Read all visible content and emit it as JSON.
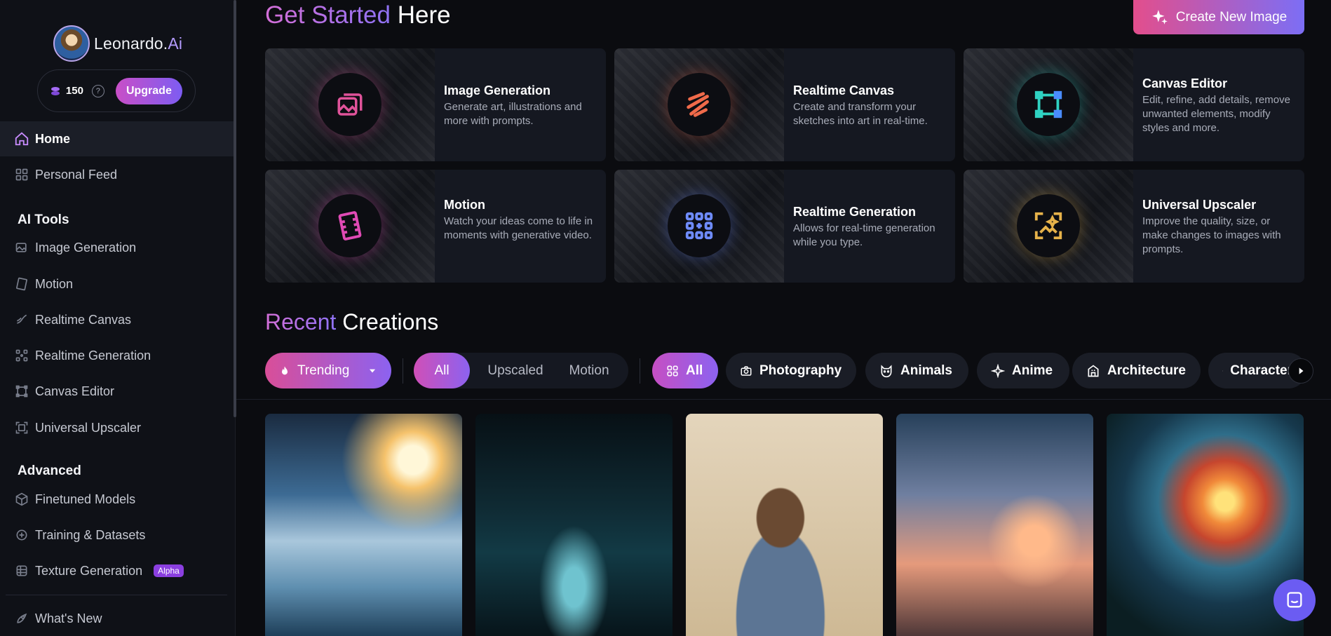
{
  "sidebar": {
    "brand": {
      "name": "Leonardo.",
      "ai": "Ai"
    },
    "tokens": {
      "count": "150",
      "help": "?",
      "upgrade_label": "Upgrade"
    },
    "nav": [
      {
        "label": "Home",
        "icon": "home-icon"
      },
      {
        "label": "Personal Feed",
        "icon": "grid-icon"
      }
    ],
    "ai_tools_heading": "AI Tools",
    "ai_tools": [
      {
        "label": "Image Generation",
        "icon": "image-icon"
      },
      {
        "label": "Motion",
        "icon": "film-icon"
      },
      {
        "label": "Realtime Canvas",
        "icon": "brush-icon"
      },
      {
        "label": "Realtime Generation",
        "icon": "dots-grid-icon"
      },
      {
        "label": "Canvas Editor",
        "icon": "frame-icon"
      },
      {
        "label": "Universal Upscaler",
        "icon": "upscale-icon"
      }
    ],
    "advanced_heading": "Advanced",
    "advanced": [
      {
        "label": "Finetuned Models",
        "icon": "cube-icon"
      },
      {
        "label": "Training & Datasets",
        "icon": "dataset-icon"
      },
      {
        "label": "Texture Generation",
        "icon": "texture-icon",
        "badge": "Alpha"
      }
    ],
    "whats_new": {
      "label": "What's New",
      "icon": "rocket-icon"
    }
  },
  "header": {
    "title_accent": "Get Started",
    "title_rest": " Here",
    "create_button": "Create New Image"
  },
  "cards": [
    {
      "title": "Image Generation",
      "desc": "Generate art, illustrations and more with prompts.",
      "icon": "image-stack-icon",
      "color": "#e0539a"
    },
    {
      "title": "Realtime Canvas",
      "desc": "Create and transform your sketches into art in real-time.",
      "icon": "squiggle-icon",
      "color": "#f06a4a"
    },
    {
      "title": "Canvas Editor",
      "desc": "Edit, refine, add details, remove unwanted elements, modify styles and more.",
      "icon": "frame-nodes-icon",
      "color": "#2fd2c2"
    },
    {
      "title": "Motion",
      "desc": "Watch your ideas come to life in moments with generative video.",
      "icon": "film-strip-icon",
      "color": "#e04ab5"
    },
    {
      "title": "Realtime Generation",
      "desc": "Allows for real-time generation while you type.",
      "icon": "dots-plus-icon",
      "color": "#6f8cff"
    },
    {
      "title": "Universal Upscaler",
      "desc": "Improve the quality, size, or make changes to images with prompts.",
      "icon": "image-sparkle-icon",
      "color": "#e6b24a"
    }
  ],
  "recent": {
    "title_accent": "Recent",
    "title_rest": " Creations",
    "trending_label": "Trending",
    "segments": [
      "All",
      "Upscaled",
      "Motion"
    ],
    "categories": [
      "All",
      "Photography",
      "Animals",
      "Anime",
      "Architecture",
      "Character"
    ]
  }
}
